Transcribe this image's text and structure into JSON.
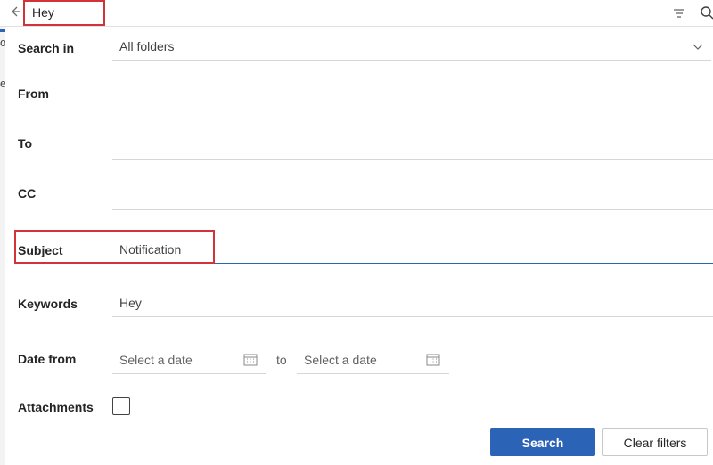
{
  "topbar": {
    "search_value": "Hey",
    "icons": {
      "back": "arrow-left-icon",
      "filter": "filter-icon",
      "search": "search-icon"
    }
  },
  "background": {
    "letters": [
      "o",
      "e"
    ]
  },
  "form": {
    "search_in": {
      "label": "Search in",
      "value": "All folders"
    },
    "from": {
      "label": "From",
      "value": ""
    },
    "to": {
      "label": "To",
      "value": ""
    },
    "cc": {
      "label": "CC",
      "value": ""
    },
    "subject": {
      "label": "Subject",
      "value": "Notification"
    },
    "keywords": {
      "label": "Keywords",
      "value": "Hey"
    },
    "date": {
      "label": "Date from",
      "from_placeholder": "Select a date",
      "to_label": "to",
      "to_placeholder": "Select a date"
    },
    "attachments": {
      "label": "Attachments",
      "checked": false
    }
  },
  "buttons": {
    "search": "Search",
    "clear": "Clear filters"
  },
  "colors": {
    "accent": "#2b63b6",
    "highlight": "#d13438"
  }
}
